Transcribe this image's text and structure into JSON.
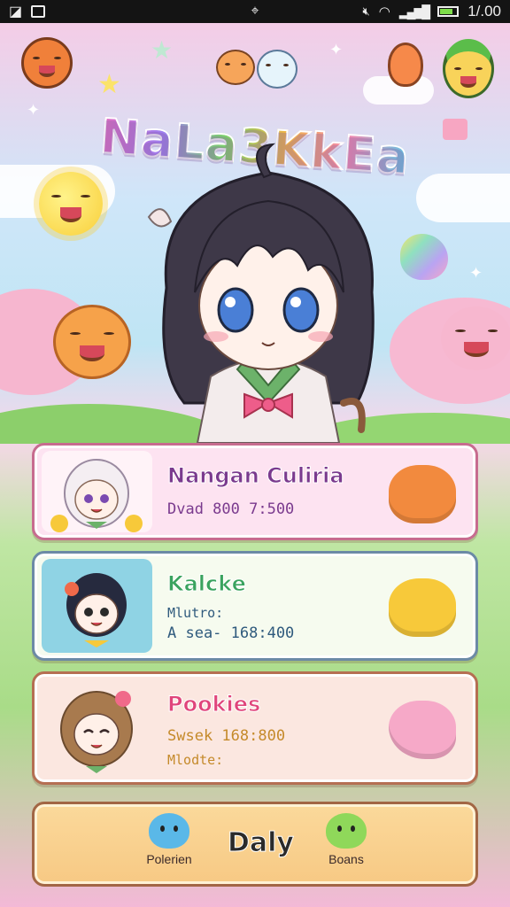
{
  "status_bar": {
    "time": "1/.00",
    "left_icons": [
      "image-icon",
      "sim-icon"
    ],
    "right_icons": [
      "mute-icon",
      "wifi-icon",
      "signal-icon",
      "battery-icon"
    ]
  },
  "game": {
    "title": "NaLa3KkEa"
  },
  "characters": [
    {
      "name": "Nangan Culiria",
      "line1": "Dvad 800 7:500",
      "line2": "",
      "name_color": "#7a3a8e",
      "line_color": "#7a3a8e",
      "card_bg": "#fde3f1",
      "card_border": "#c76c8f",
      "avatar_bg": "#fff3f8",
      "pet_color": "#f28a3e",
      "avatar": "white-haired-girl-avatar",
      "pet": "orange-slime-pet"
    },
    {
      "name": "Kalcke",
      "line1": "Mlutro:",
      "line2": "A sea- 168:400",
      "name_color": "#3aa35e",
      "line_color": "#2f5a7d",
      "card_bg": "#f6fbef",
      "card_border": "#6c8aa6",
      "avatar_bg": "#8fd3e4",
      "pet_color": "#f7c93a",
      "avatar": "dark-haired-boy-avatar",
      "pet": "yellow-cat-pet"
    },
    {
      "name": "Pookies",
      "line1": "Swsek 168:800",
      "line2": "Mlodte:",
      "name_color": "#e0457b",
      "line_color": "#c58a2a",
      "card_bg": "#fbe7e0",
      "card_border": "#b56f52",
      "avatar_bg": "#fbe7e0",
      "pet_color": "#f6a9c8",
      "avatar": "brown-haired-girl-avatar",
      "pet": "pink-ghost-pet"
    }
  ],
  "bottom_nav": {
    "left_label": "Polerien",
    "center_label": "Daly",
    "right_label": "Boans",
    "left_color": "#5ab8e8",
    "right_color": "#8fd85a"
  }
}
